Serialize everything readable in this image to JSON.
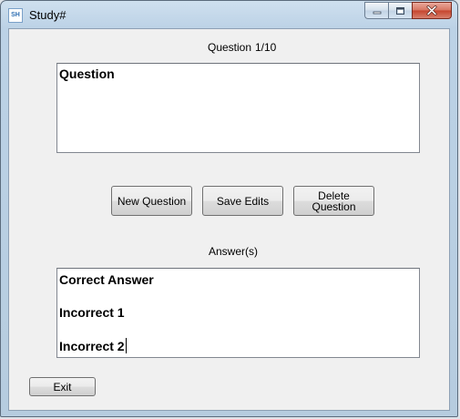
{
  "window": {
    "title": "Study#",
    "icon_text": "SH",
    "icon": "app-icon"
  },
  "caption_buttons": {
    "minimize_icon": "minimize-icon",
    "maximize_icon": "maximize-icon",
    "close_icon": "close-icon"
  },
  "question": {
    "header_label": "Question",
    "counter": "1/10",
    "text": "Question"
  },
  "buttons": {
    "new_question": "New Question",
    "save_edits": "Save Edits",
    "delete_line1": "Delete",
    "delete_line2": "Question",
    "exit": "Exit"
  },
  "answers": {
    "label": "Answer(s)",
    "lines": [
      "Correct Answer",
      "Incorrect 1",
      "Incorrect 2"
    ]
  }
}
